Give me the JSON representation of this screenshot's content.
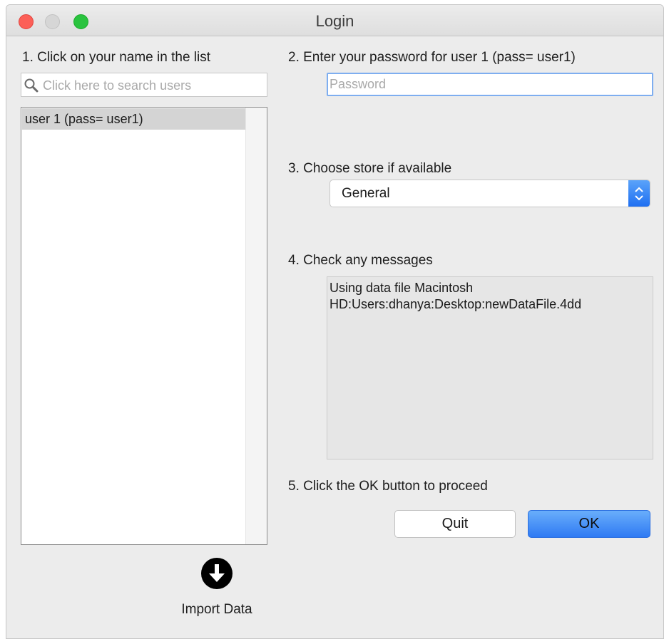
{
  "window": {
    "title": "Login"
  },
  "steps": {
    "step1": "1. Click on your name in the list",
    "step2": "2. Enter your password for user 1 (pass= user1)",
    "step3": "3. Choose store if available",
    "step4": "4. Check any messages",
    "step5": "5. Click the OK button to proceed"
  },
  "search": {
    "placeholder": "Click here to search users",
    "icon": "search-icon"
  },
  "users": [
    {
      "label": "user 1 (pass= user1)",
      "selected": true
    }
  ],
  "password": {
    "placeholder": "Password",
    "value": ""
  },
  "store": {
    "selected": "General",
    "icon": "up-down-chevron-icon"
  },
  "messages": {
    "lines": [
      "Using data file Macintosh",
      "HD:Users:dhanya:Desktop:newDataFile.4dd"
    ]
  },
  "buttons": {
    "quit": "Quit",
    "ok": "OK"
  },
  "import": {
    "label": "Import Data",
    "icon": "download-arrow-icon"
  },
  "colors": {
    "accent": "#2f7af3",
    "close": "#fc5f57",
    "maximize": "#2ac33f"
  }
}
